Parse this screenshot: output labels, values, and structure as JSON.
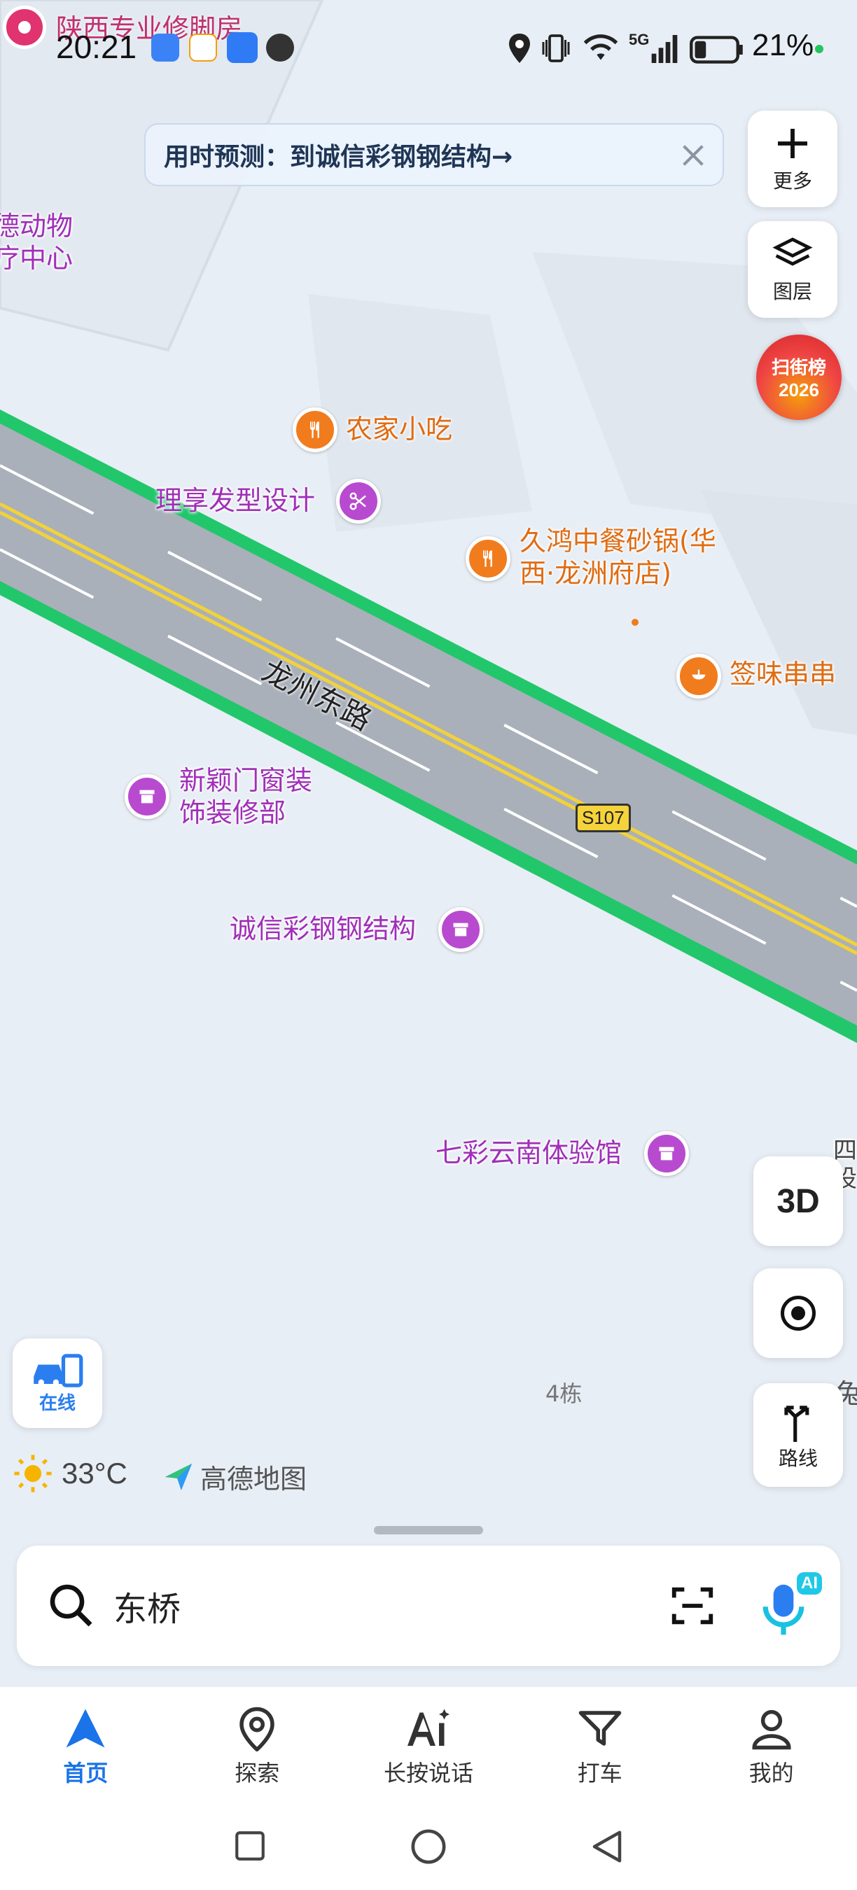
{
  "status_bar": {
    "top_label": "陕西专业修脚房",
    "time": "20:21",
    "network": "5G",
    "battery": "21%"
  },
  "route_banner": {
    "text": "用时预测：到诚信彩钢钢结构→"
  },
  "right_controls": {
    "more_label": "更多",
    "layers_label": "图层",
    "ranking_line1": "扫街榜",
    "ranking_line2": "2026",
    "three_d_label": "3D",
    "route_label": "路线"
  },
  "map": {
    "road_name": "龙州东路",
    "road_shield": "S107",
    "partial_top_left": "德动物\n疗中心",
    "building_label": "4栋",
    "pois": [
      {
        "name": "农家小吃",
        "type": "orange"
      },
      {
        "name": "理享发型设计",
        "type": "purple"
      },
      {
        "name": "久鸿中餐砂锅(华\n西·龙洲府店)",
        "type": "orange"
      },
      {
        "name": "签味串串",
        "type": "orange"
      },
      {
        "name": "新颖门窗装\n饰装修部",
        "type": "purple"
      },
      {
        "name": "诚信彩钢钢结构",
        "type": "purple"
      },
      {
        "name": "七彩云南体验馆",
        "type": "purple"
      }
    ],
    "partial_right_1": "四\n设",
    "partial_right_2": "兔"
  },
  "online_button": {
    "label": "在线"
  },
  "weather": {
    "temp": "33°C",
    "brand": "高德地图"
  },
  "search": {
    "value": "东桥",
    "ai_badge": "AI"
  },
  "tabs": [
    {
      "label": "首页",
      "active": true
    },
    {
      "label": "探索",
      "active": false
    },
    {
      "label": "长按说话",
      "active": false
    },
    {
      "label": "打车",
      "active": false
    },
    {
      "label": "我的",
      "active": false
    }
  ],
  "colors": {
    "accent": "#1a73e8",
    "road_edge": "#22c76b",
    "road": "#a9b0ba",
    "poi_purple": "#a02fb8",
    "poi_orange": "#e06c12"
  }
}
